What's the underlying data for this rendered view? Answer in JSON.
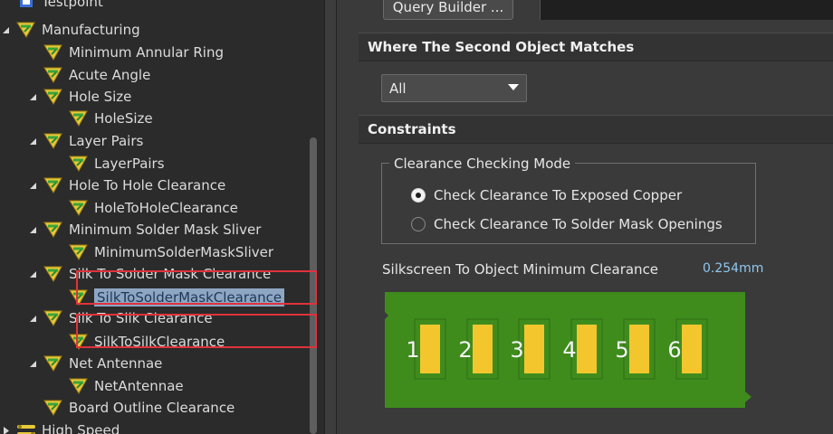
{
  "tree": {
    "items": [
      {
        "label": "Testpoint",
        "icon": "blue-rule-icon",
        "caret": "none",
        "selected": false
      },
      {
        "label": "Manufacturing",
        "icon": "rule-category-icon",
        "caret": "expanded",
        "selected": false
      },
      {
        "label": "Minimum Annular Ring",
        "icon": "rule-icon",
        "caret": "none",
        "selected": false
      },
      {
        "label": "Acute Angle",
        "icon": "rule-icon",
        "caret": "none",
        "selected": false
      },
      {
        "label": "Hole Size",
        "icon": "rule-icon",
        "caret": "expanded",
        "selected": false
      },
      {
        "label": "HoleSize",
        "icon": "rule-icon",
        "caret": "none",
        "selected": false
      },
      {
        "label": "Layer Pairs",
        "icon": "rule-icon",
        "caret": "expanded",
        "selected": false
      },
      {
        "label": "LayerPairs",
        "icon": "rule-icon",
        "caret": "none",
        "selected": false
      },
      {
        "label": "Hole To Hole Clearance",
        "icon": "rule-icon",
        "caret": "expanded",
        "selected": false
      },
      {
        "label": "HoleToHoleClearance",
        "icon": "rule-icon",
        "caret": "none",
        "selected": false
      },
      {
        "label": "Minimum Solder Mask Sliver",
        "icon": "rule-icon",
        "caret": "expanded",
        "selected": false
      },
      {
        "label": "MinimumSolderMaskSliver",
        "icon": "rule-icon",
        "caret": "none",
        "selected": false
      },
      {
        "label": "Silk To Solder Mask Clearance",
        "icon": "rule-icon",
        "caret": "expanded",
        "selected": false
      },
      {
        "label": "SilkToSolderMaskClearance",
        "icon": "rule-icon",
        "caret": "none",
        "selected": true
      },
      {
        "label": "Silk To Silk Clearance",
        "icon": "rule-icon",
        "caret": "expanded",
        "selected": false
      },
      {
        "label": "SilkToSilkClearance",
        "icon": "rule-icon",
        "caret": "none",
        "selected": false
      },
      {
        "label": "Net Antennae",
        "icon": "rule-icon",
        "caret": "expanded",
        "selected": false
      },
      {
        "label": "NetAntennae",
        "icon": "rule-icon",
        "caret": "none",
        "selected": false
      },
      {
        "label": "Board Outline Clearance",
        "icon": "rule-icon",
        "caret": "none",
        "selected": false
      },
      {
        "label": "High Speed",
        "icon": "high-speed-icon",
        "caret": "collapsed",
        "selected": false
      }
    ]
  },
  "toolbar": {
    "query_builder_label": "Query Builder ..."
  },
  "second_object": {
    "header": "Where The Second Object Matches",
    "selected_option": "All"
  },
  "constraints": {
    "header": "Constraints",
    "mode_group_title": "Clearance Checking Mode",
    "options": [
      {
        "label": "Check Clearance To Exposed Copper",
        "checked": true
      },
      {
        "label": "Check Clearance To Solder Mask Openings",
        "checked": false
      }
    ],
    "clearance_label": "Silkscreen To Object Minimum Clearance",
    "clearance_value": "0.254mm",
    "pad_numbers": [
      "1",
      "2",
      "3",
      "4",
      "5",
      "6"
    ]
  },
  "colors": {
    "selection": "#8ea6c4",
    "highlight_box": "#e0323c",
    "value_text": "#8fc8ee",
    "pcb_green": "#3f8c1d",
    "pad_yellow": "#f2c62c"
  }
}
